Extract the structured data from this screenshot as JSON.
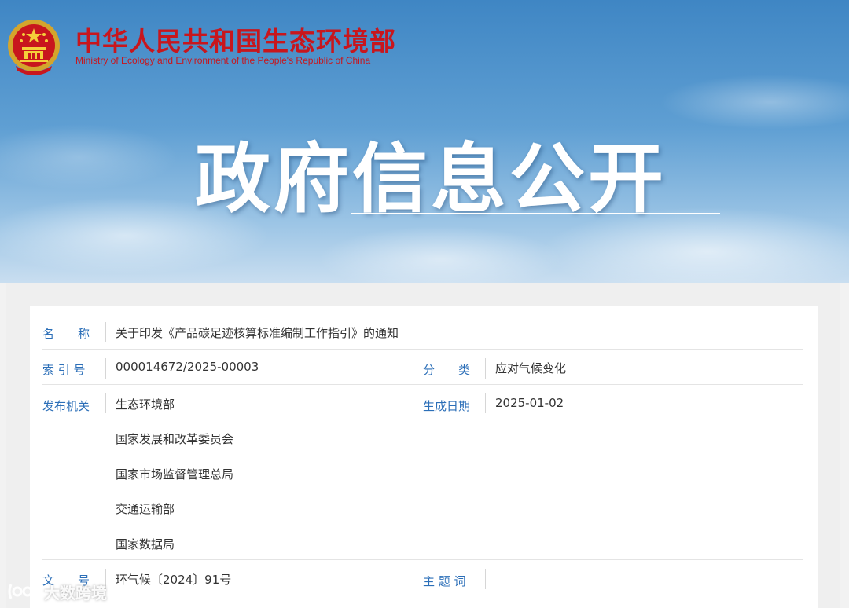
{
  "header": {
    "ministry_cn": "中华人民共和国生态环境部",
    "ministry_en": "Ministry of Ecology and Environment of the People's Republic of China",
    "banner_title": "政府信息公开"
  },
  "info": {
    "name_label": "名　　称",
    "name_value": "关于印发《产品碳足迹核算标准编制工作指引》的通知",
    "index_label": "索 引 号",
    "index_value": "000014672/2025-00003",
    "category_label": "分　　类",
    "category_value": "应对气候变化",
    "issuer_label": "发布机关",
    "issuers": [
      "生态环境部",
      "国家发展和改革委员会",
      "国家市场监督管理总局",
      "交通运输部",
      "国家数据局"
    ],
    "date_label": "生成日期",
    "date_value": "2025-01-02",
    "doc_no_label": "文　　号",
    "doc_no_value": "环气候〔2024〕91号",
    "keywords_label": "主 题 词",
    "keywords_value": ""
  },
  "watermark": {
    "text": "大数跨境"
  },
  "colors": {
    "brand_red": "#c8161d",
    "label_blue": "#2c6fb8",
    "value_text": "#333333"
  }
}
